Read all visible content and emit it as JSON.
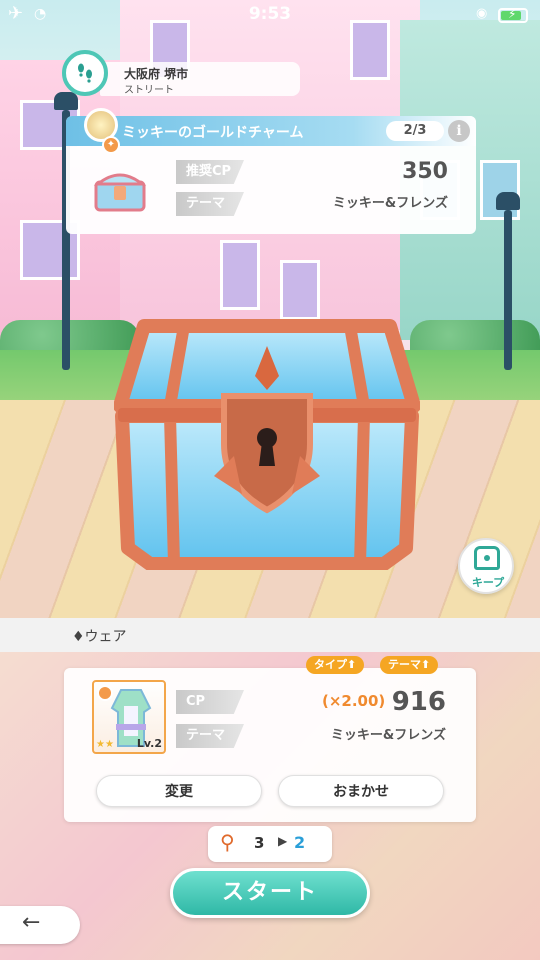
{
  "status_bar": {
    "time": "9:53",
    "airplane_icon": "airplane-icon",
    "wifi_icon": "wifi-icon",
    "battery_level": 0.85
  },
  "location": {
    "prefecture_city": "大阪府 堺市",
    "street": "ストリート",
    "icon": "footprints-icon"
  },
  "quest": {
    "title": "ミッキーのゴールドチャーム",
    "progress": "2/3",
    "info_icon": "i",
    "recommended_cp_label": "推奨CP",
    "recommended_cp_value": "350",
    "theme_label": "テーマ",
    "theme_value": "ミッキー&フレンズ"
  },
  "keep_button": {
    "label": "キープ",
    "icon": "chest-icon"
  },
  "wear": {
    "section_label": "♦ウェア",
    "type_tag": "タイプ⬆",
    "theme_tag": "テーマ⬆",
    "cp_label": "CP",
    "multiplier": "(×2.00)",
    "cp_value": "916",
    "theme_label": "テーマ",
    "theme_value": "ミッキー&フレンズ",
    "item_level": "Lv.2",
    "item_stars": "★★",
    "change_button": "変更",
    "auto_button": "おまかせ"
  },
  "keys": {
    "from": "3",
    "arrow": "▶",
    "to": "2",
    "icon": "key-icon"
  },
  "start_button": "スタート",
  "back_button": "←",
  "colors": {
    "accent": "#2fb8a6",
    "orange": "#f5a623",
    "chest": "#e07c58"
  }
}
